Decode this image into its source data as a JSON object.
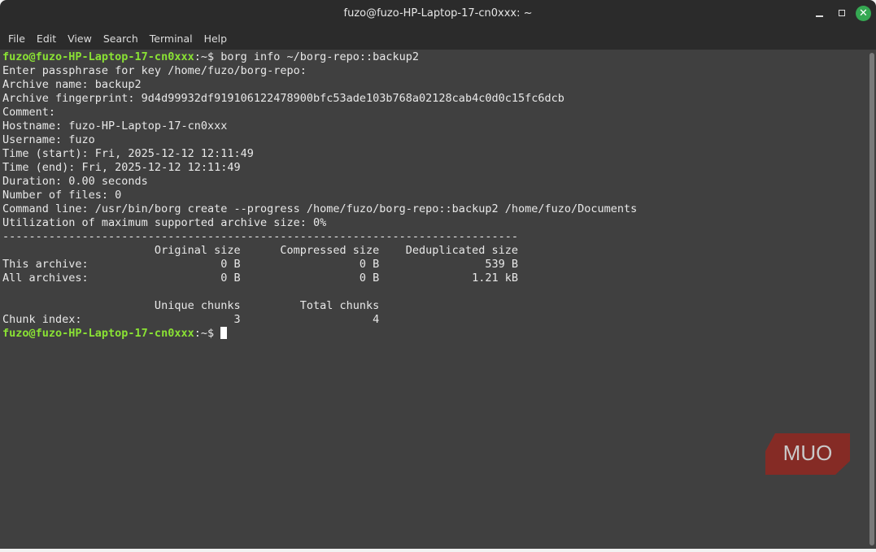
{
  "window": {
    "title": "fuzo@fuzo-HP-Laptop-17-cn0xxx: ~",
    "close_icon": "close-icon"
  },
  "menu": [
    "File",
    "Edit",
    "View",
    "Search",
    "Terminal",
    "Help"
  ],
  "terminal": {
    "prompt": "fuzo@fuzo-HP-Laptop-17-cn0xxx",
    "prompt_suffix": ":~$ ",
    "command": "borg info ~/borg-repo::backup2",
    "output": "Enter passphrase for key /home/fuzo/borg-repo:\nArchive name: backup2\nArchive fingerprint: 9d4d99932df919106122478900bfc53ade103b768a02128cab4c0d0c15fc6dcb\nComment:\nHostname: fuzo-HP-Laptop-17-cn0xxx\nUsername: fuzo\nTime (start): Fri, 2025-12-12 12:11:49\nTime (end): Fri, 2025-12-12 12:11:49\nDuration: 0.00 seconds\nNumber of files: 0\nCommand line: /usr/bin/borg create --progress /home/fuzo/borg-repo::backup2 /home/fuzo/Documents\nUtilization of maximum supported archive size: 0%\n------------------------------------------------------------------------------\n                       Original size      Compressed size    Deduplicated size\nThis archive:                    0 B                  0 B                539 B\nAll archives:                    0 B                  0 B              1.21 kB\n\n                       Unique chunks         Total chunks\nChunk index:                       3                    4",
    "prompt2": "fuzo@fuzo-HP-Laptop-17-cn0xxx",
    "prompt2_suffix": ":~$ "
  },
  "watermark": "MUO"
}
